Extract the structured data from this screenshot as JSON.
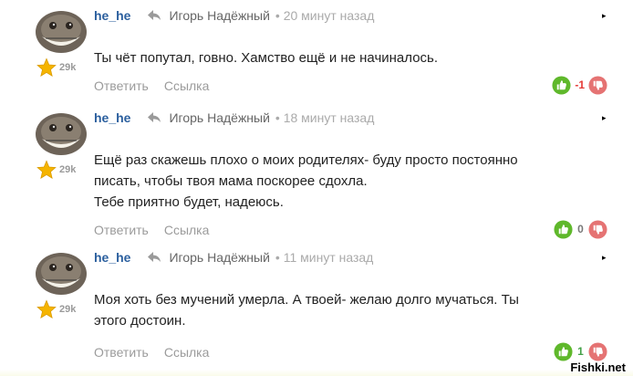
{
  "comments": [
    {
      "author": "he_he",
      "reply_to": "Игорь Надёжный",
      "time": "• 20 минут назад",
      "rating": "29k",
      "text_lines": [
        "Ты чёт попутал, говно. Хамство ещё и не начиналось."
      ],
      "reply_label": "Ответить",
      "link_label": "Ссылка",
      "vote_score": "-1",
      "score_color": "#e53935"
    },
    {
      "author": "he_he",
      "reply_to": "Игорь Надёжный",
      "time": "• 18 минут назад",
      "rating": "29k",
      "text_lines": [
        "Ещё раз скажешь плохо о моих родителях- буду просто постоянно",
        "писать, чтобы твоя мама поскорее сдохла.",
        "Тебе приятно будет, надеюсь."
      ],
      "reply_label": "Ответить",
      "link_label": "Ссылка",
      "vote_score": "0",
      "score_color": "#777777"
    },
    {
      "author": "he_he",
      "reply_to": "Игорь Надёжный",
      "time": "• 11 минут назад",
      "rating": "29k",
      "text_lines": [
        "Моя хоть без мучений умерла. А твоей- желаю долго мучаться. Ты",
        "этого достоин."
      ],
      "reply_label": "Ответить",
      "link_label": "Ссылка",
      "vote_score": "1",
      "score_color": "#43a047"
    }
  ],
  "icons": {
    "reply_to": "reply-arrow-icon",
    "rating": "star-icon",
    "upvote": "thumbs-up-icon",
    "downvote": "thumbs-down-icon",
    "menu": "menu-dot-icon"
  },
  "colors": {
    "author": "#2b5f9e",
    "upvote": "#5fb82b",
    "downvote": "#e57373",
    "star": "#f5b400"
  },
  "watermark": "Fishki.net"
}
